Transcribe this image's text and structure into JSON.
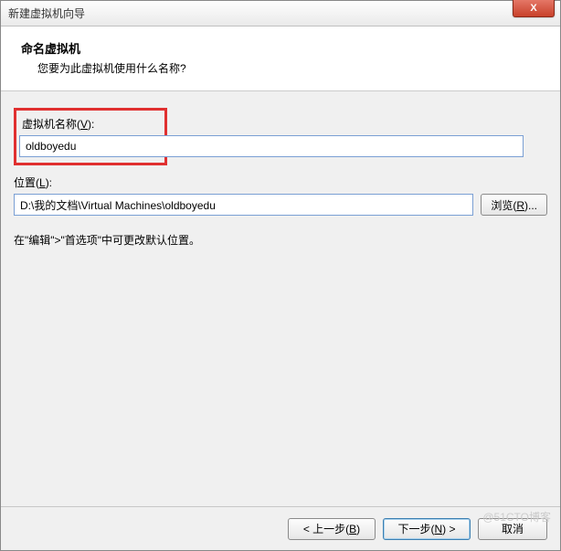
{
  "window": {
    "title": "新建虚拟机向导"
  },
  "close": {
    "glyph": "X"
  },
  "header": {
    "title": "命名虚拟机",
    "subtitle": "您要为此虚拟机使用什么名称?"
  },
  "fields": {
    "name": {
      "label_prefix": "虚拟机名称(",
      "label_key": "V",
      "label_suffix": "):",
      "value": "oldboyedu"
    },
    "location": {
      "label_prefix": "位置(",
      "label_key": "L",
      "label_suffix": "):",
      "value": "D:\\我的文档\\Virtual Machines\\oldboyedu",
      "browse_prefix": "浏览(",
      "browse_key": "R",
      "browse_suffix": ")..."
    }
  },
  "hint": "在\"编辑\">\"首选项\"中可更改默认位置。",
  "footer": {
    "back_prefix": "< 上一步(",
    "back_key": "B",
    "back_suffix": ")",
    "next_prefix": "下一步(",
    "next_key": "N",
    "next_suffix": ") >",
    "cancel": "取消"
  },
  "watermark": "@51CTO博客"
}
